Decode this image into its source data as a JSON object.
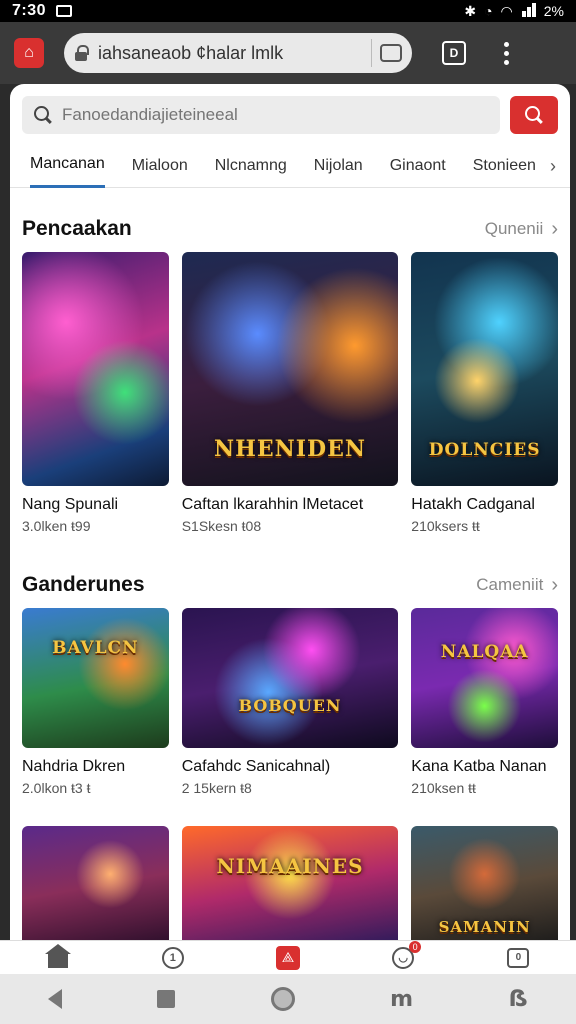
{
  "status_bar": {
    "time": "7:30",
    "battery": "2%"
  },
  "browser": {
    "url": "iahsaneaob ¢halar lmlk",
    "tab_count": "D"
  },
  "search": {
    "placeholder": "Fanoedandiajieteineeal"
  },
  "tabs": [
    {
      "label": "Mancanan",
      "active": true
    },
    {
      "label": "Mialoon"
    },
    {
      "label": "Nlcnamng"
    },
    {
      "label": "Nijolan"
    },
    {
      "label": "Ginaont"
    },
    {
      "label": "Stonieen"
    }
  ],
  "sections": [
    {
      "title": "Pencaakan",
      "more": "Qunenii",
      "cards": [
        {
          "title": "Nang Spunali",
          "meta": "3.0lken ŧ99",
          "logo": ""
        },
        {
          "title": "Caftan lkarahhin lMetacet",
          "meta": "S1Skesn ŧ08",
          "logo": "NHENIDEN"
        },
        {
          "title": "Hatakh Cadganal",
          "meta": "210ksers ŧŧ",
          "logo": "DOLNCIES"
        }
      ]
    },
    {
      "title": "Ganderunes",
      "more": "Cameniit",
      "cards": [
        {
          "title": "Nahdria Dkren",
          "meta": "2.0lkon ŧ3 ŧ",
          "logo": "BAVLCN"
        },
        {
          "title": "Cafahdc Sanicahnal)",
          "meta": "2 15kern ŧ8",
          "logo": "BOBQUEN"
        },
        {
          "title": "Kana Katba Nanan",
          "meta": "210ksen ŧŧ",
          "logo": "NALQAA"
        }
      ]
    },
    {
      "title": "",
      "more": "",
      "cards": [
        {
          "title": "",
          "meta": "",
          "logo": ""
        },
        {
          "title": "",
          "meta": "",
          "logo": "NIMAAINES"
        },
        {
          "title": "",
          "meta": "",
          "logo": "SAMANIN"
        }
      ]
    }
  ],
  "bottom_nav": [
    {
      "icon": "home-icon"
    },
    {
      "icon": "clock-icon",
      "glyph": "1"
    },
    {
      "icon": "game-icon",
      "glyph": "⟁"
    },
    {
      "icon": "notifications-icon",
      "badge": "0"
    },
    {
      "icon": "library-icon",
      "glyph": "0"
    }
  ],
  "colors": {
    "accent": "#d9302f",
    "tab_underline": "#2c6fb7"
  }
}
